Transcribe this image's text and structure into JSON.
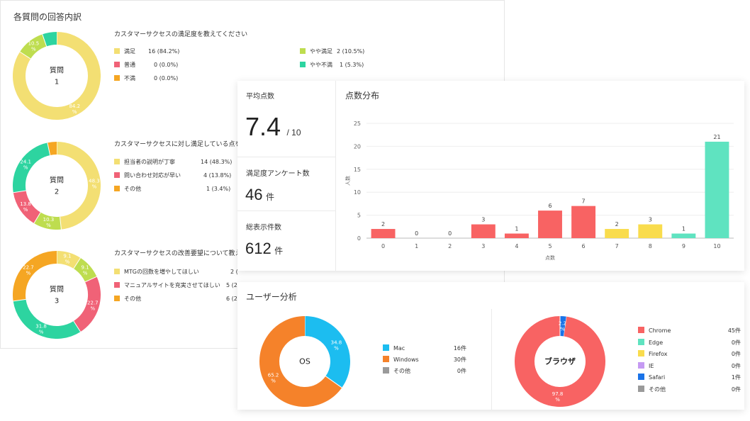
{
  "questions_panel": {
    "title": "各質問の回答内訳",
    "questions": [
      {
        "center": [
          "質問",
          "1"
        ],
        "heading": "カスタマーサクセスの満足度を教えてください",
        "slices": [
          {
            "label": "満足",
            "value": "16 (84.2%)",
            "pct": 84.2,
            "color": "#f3df73",
            "tag": "84.2\n%"
          },
          {
            "label": "普通",
            "value": "0 (0.0%)",
            "pct": 0,
            "color": "#f06277",
            "tag": ""
          },
          {
            "label": "不満",
            "value": "0 (0.0%)",
            "pct": 0,
            "color": "#f5a623",
            "tag": ""
          },
          {
            "label": "やや満足",
            "value": "2 (10.5%)",
            "pct": 10.5,
            "color": "#bedd4f",
            "tag": "10.5\n%"
          },
          {
            "label": "やや不満",
            "value": "1 (5.3%)",
            "pct": 5.3,
            "color": "#2dd4a0",
            "tag": ""
          }
        ]
      },
      {
        "center": [
          "質問",
          "2"
        ],
        "heading": "カスタマーサクセスに対し満足している点を",
        "slices": [
          {
            "label": "担当者の説明が丁寧",
            "value": "14 (48.3%)",
            "pct": 48.3,
            "color": "#f3df73",
            "tag": "48.3\n%"
          },
          {
            "label": "問い合わせ対応が早い",
            "value": "4 (13.8%)",
            "pct": 13.8,
            "color": "#f06277",
            "tag": "13.8\n%"
          },
          {
            "label": "その他",
            "value": "1 (3.4%)",
            "pct": 3.4,
            "color": "#f5a623",
            "tag": ""
          }
        ],
        "extra_slices": [
          {
            "pct": 10.3,
            "color": "#bedd4f",
            "tag": "10.3\n%"
          },
          {
            "pct": 24.1,
            "color": "#2dd4a0",
            "tag": "24.1\n%"
          }
        ]
      },
      {
        "center": [
          "質問",
          "3"
        ],
        "heading": "カスタマーサクセスの改善要望について教え",
        "slices": [
          {
            "label": "MTGの回数を増やしてほしい",
            "value": "2 (",
            "pct": 9.1,
            "color": "#f3df73",
            "tag": "9.1\n%"
          },
          {
            "label": "マニュアルサイトを充実させてほしい",
            "value": "5 (2",
            "pct": 22.7,
            "color": "#f06277",
            "tag": "22.7\n%"
          },
          {
            "label": "その他",
            "value": "6 (2",
            "pct": 27.3,
            "color": "#f5a623",
            "tag": "22.7\n%"
          }
        ],
        "extra_slices": [
          {
            "pct": 9.1,
            "color": "#bedd4f",
            "tag": "9.1\n%"
          },
          {
            "pct": 31.8,
            "color": "#2dd4a0",
            "tag": "31.8\n%"
          }
        ]
      }
    ]
  },
  "stats": {
    "avg_label": "平均点数",
    "avg_value": "7.4",
    "avg_suffix": "/ 10",
    "survey_label": "満足度アンケート数",
    "survey_value": "46",
    "survey_unit": "件",
    "total_label": "総表示件数",
    "total_value": "612",
    "total_unit": "件"
  },
  "chart_data": {
    "type": "bar",
    "title": "点数分布",
    "xlabel": "点数",
    "ylabel": "人数",
    "categories": [
      "0",
      "1",
      "2",
      "3",
      "4",
      "5",
      "6",
      "7",
      "8",
      "9",
      "10"
    ],
    "values": [
      2,
      0,
      0,
      3,
      1,
      6,
      7,
      2,
      3,
      1,
      21
    ],
    "colors": [
      "#f86363",
      "#f86363",
      "#f86363",
      "#f86363",
      "#f86363",
      "#f86363",
      "#f86363",
      "#f9dc4d",
      "#f9dc4d",
      "#5fe3c0",
      "#5fe3c0"
    ],
    "ylim": [
      0,
      25
    ],
    "yticks": [
      0,
      5,
      10,
      15,
      20,
      25
    ],
    "grid": true
  },
  "user_analysis": {
    "title": "ユーザー分析",
    "os": {
      "center": "OS",
      "items": [
        {
          "label": "Mac",
          "value": "16件",
          "pct": 34.8,
          "color": "#1cbdf0",
          "tag": "34.8\n%"
        },
        {
          "label": "Windows",
          "value": "30件",
          "pct": 65.2,
          "color": "#f5822a",
          "tag": "65.2\n%"
        },
        {
          "label": "その他",
          "value": "0件",
          "pct": 0,
          "color": "#9a9a9a",
          "tag": ""
        }
      ]
    },
    "browser": {
      "center": "ブラウザ",
      "items": [
        {
          "label": "Chrome",
          "value": "45件",
          "pct": 97.8,
          "color": "#f86363",
          "tag": "97.8\n%"
        },
        {
          "label": "Edge",
          "value": "0件",
          "pct": 0,
          "color": "#5fe3c0",
          "tag": ""
        },
        {
          "label": "Firefox",
          "value": "0件",
          "pct": 0,
          "color": "#f9dc4d",
          "tag": ""
        },
        {
          "label": "IE",
          "value": "0件",
          "pct": 0,
          "color": "#c59af3",
          "tag": ""
        },
        {
          "label": "Safari",
          "value": "1件",
          "pct": 2.2,
          "color": "#1a73e8",
          "tag": "2.2\n%"
        },
        {
          "label": "その他",
          "value": "0件",
          "pct": 0,
          "color": "#9a9a9a",
          "tag": ""
        }
      ]
    }
  }
}
